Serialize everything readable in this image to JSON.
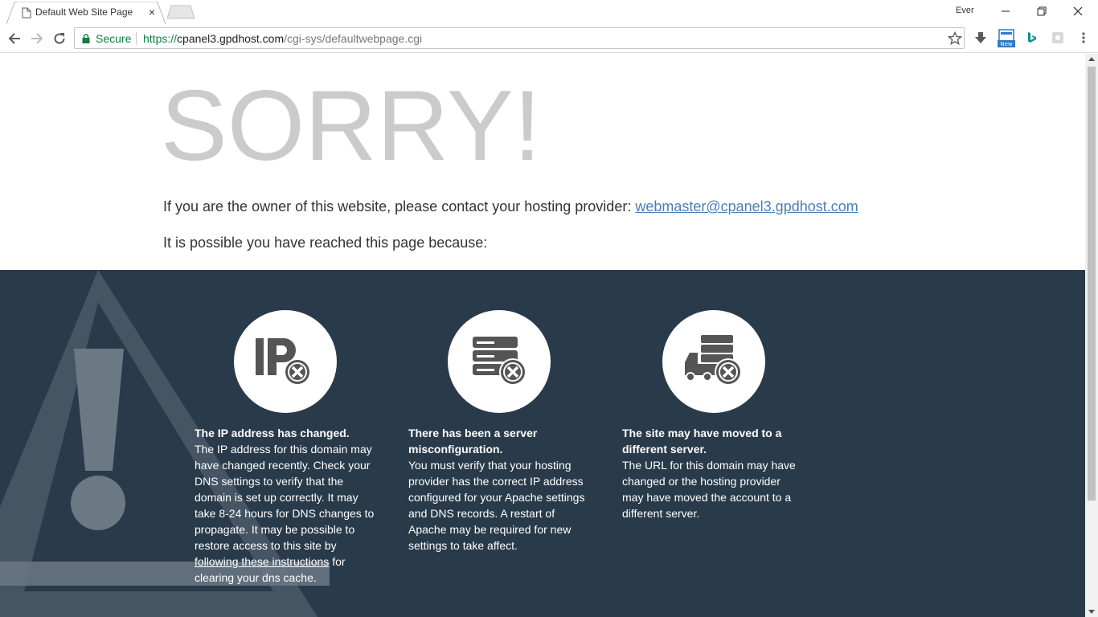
{
  "browser": {
    "tab_title": "Default Web Site Page",
    "tab_close": "×",
    "profile_name": "Ever",
    "security_label": "Secure",
    "url_scheme": "https://",
    "url_host": "cpanel3.gpdhost.com",
    "url_path": "/cgi-sys/defaultwebpage.cgi",
    "ext_badge": "New"
  },
  "page": {
    "headline": "SORRY!",
    "contact_text": "If you are the owner of this website, please contact your hosting provider: ",
    "contact_email": "webmaster@cpanel3.gpdhost.com",
    "reasons_intro": "It is possible you have reached this page because:",
    "reasons": [
      {
        "title": "The IP address has changed.",
        "body_before": "The IP address for this domain may have changed recently. Check your DNS settings to verify that the domain is set up correctly. It may take 8-24 hours for DNS changes to propagate. It may be possible to restore access to this site by ",
        "link": "following these instructions",
        "body_after": " for clearing your dns cache."
      },
      {
        "title": "There has been a server misconfiguration.",
        "body": "You must verify that your hosting provider has the correct IP address configured for your Apache settings and DNS records. A restart of Apache may be required for new settings to take affect."
      },
      {
        "title": "The site may have moved to a different server.",
        "body": "The URL for this domain may have changed or the hosting provider may have moved the account to a different server."
      }
    ]
  },
  "colors": {
    "dark_band": "#293a4a",
    "headline": "#cbcbcb",
    "link": "#4a7fb5",
    "secure_green": "#0b8043"
  },
  "icons": [
    "page-icon",
    "back-arrow-icon",
    "forward-arrow-icon",
    "reload-icon",
    "lock-icon",
    "star-icon",
    "download-icon",
    "bing-icon",
    "menu-icon",
    "ip-error-icon",
    "server-error-icon",
    "truck-error-icon",
    "warning-icon"
  ]
}
